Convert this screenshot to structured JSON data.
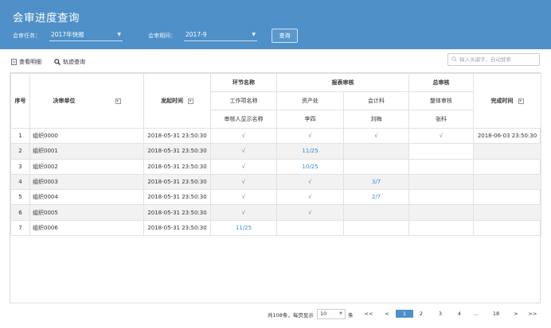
{
  "header": {
    "title": "会审进度查询",
    "task_label": "会审任务：",
    "task_value": "2017年快报",
    "period_label": "会审期间：",
    "period_value": "2017-9",
    "query_button": "查询"
  },
  "toolbar": {
    "view_detail": "查看明细",
    "track_query": "轨迹查询",
    "search_placeholder": "输入关键字，自动搜索"
  },
  "table": {
    "headers": {
      "seq": "序号",
      "unit": "决审单位",
      "time": "发起时间",
      "step_name": "环节名称",
      "report_review": "报表审核",
      "final_review": "总审核",
      "done_time": "完成时间",
      "work_item_name": "工作项名称",
      "assets": "资产处",
      "accounting": "会计科",
      "overall": "整体审核",
      "reviewer_display": "审核人显示名称",
      "li_si": "李四",
      "liu_mei": "刘梅",
      "zhang_ke": "张科"
    },
    "rows": [
      {
        "no": "1",
        "unit": "组织0000",
        "time": "2018-05-31 23:50:30",
        "step": "√",
        "assets": "√",
        "accounting": "√",
        "overall": "√",
        "done": "2018-06-03 23:50:30"
      },
      {
        "no": "2",
        "unit": "组织0001",
        "time": "2018-05-31 23:50:30",
        "step": "√",
        "assets": "11/25",
        "accounting": "",
        "overall": "",
        "done": ""
      },
      {
        "no": "3",
        "unit": "组织0002",
        "time": "2018-05-31 23:50:30",
        "step": "√",
        "assets": "10/25",
        "accounting": "",
        "overall": "",
        "done": ""
      },
      {
        "no": "4",
        "unit": "组织0003",
        "time": "2018-05-31 23:50:30",
        "step": "√",
        "assets": "√",
        "accounting": "3/7",
        "overall": "",
        "done": ""
      },
      {
        "no": "5",
        "unit": "组织0004",
        "time": "2018-05-31 23:50:30",
        "step": "√",
        "assets": "√",
        "accounting": "2/7",
        "overall": "",
        "done": ""
      },
      {
        "no": "6",
        "unit": "组织0005",
        "time": "2018-05-31 23:50:30",
        "step": "√",
        "assets": "√",
        "accounting": "",
        "overall": "",
        "done": ""
      },
      {
        "no": "7",
        "unit": "组织0006",
        "time": "2018-05-31 23:50:30",
        "step": "11/25",
        "assets": "",
        "accounting": "",
        "overall": "",
        "done": ""
      }
    ]
  },
  "pager": {
    "total_text": "共108条，每页显示",
    "page_size": "10",
    "unit": "条",
    "first": "<<",
    "prev": "<",
    "pages": [
      "1",
      "2",
      "3",
      "4"
    ],
    "ellipsis": "...",
    "last_page": "18",
    "next": ">",
    "last": ">>"
  },
  "colors": {
    "header_bg": "#4f90c8",
    "accent": "#3a8cd0"
  }
}
